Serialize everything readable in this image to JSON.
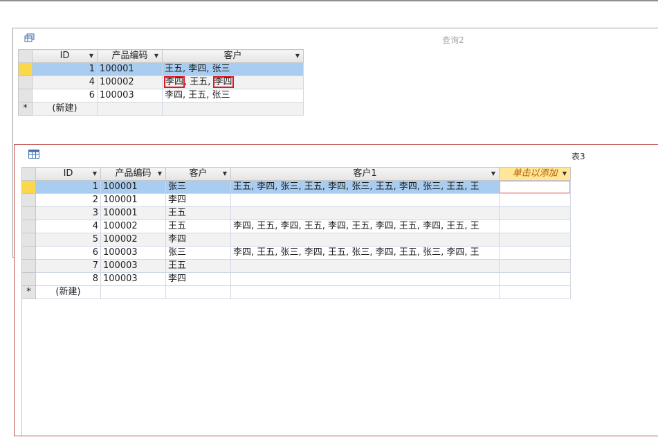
{
  "query_window": {
    "title": "查询2",
    "icon": "query-icon",
    "columns": [
      "ID",
      "产品编码",
      "客户"
    ],
    "rows": [
      {
        "id": "1",
        "code": "100001",
        "customer_parts": [
          "王五, 李四, 张三"
        ]
      },
      {
        "id": "4",
        "code": "100002",
        "customer_parts": [
          "李四",
          ", 王五, ",
          "李四"
        ]
      },
      {
        "id": "6",
        "code": "100003",
        "customer_parts": [
          "李四, 王五, 张三"
        ]
      }
    ],
    "new_row_label": "(新建)",
    "new_row_marker": "*"
  },
  "table_window": {
    "title": "表3",
    "icon": "table-icon",
    "columns": [
      "ID",
      "产品编码",
      "客户",
      "客户1",
      "单击以添加"
    ],
    "rows": [
      {
        "id": "1",
        "code": "100001",
        "customer": "张三",
        "customer1": "王五, 李四, 张三, 王五, 李四, 张三, 王五, 李四, 张三, 王五, 王"
      },
      {
        "id": "2",
        "code": "100001",
        "customer": "李四",
        "customer1": ""
      },
      {
        "id": "3",
        "code": "100001",
        "customer": "王五",
        "customer1": ""
      },
      {
        "id": "4",
        "code": "100002",
        "customer": "王五",
        "customer1": "李四, 王五, 李四, 王五, 李四, 王五, 李四, 王五, 李四, 王五, 王"
      },
      {
        "id": "5",
        "code": "100002",
        "customer": "李四",
        "customer1": ""
      },
      {
        "id": "6",
        "code": "100003",
        "customer": "张三",
        "customer1": "李四, 王五, 张三, 李四, 王五, 张三, 李四, 王五, 张三, 李四, 王"
      },
      {
        "id": "7",
        "code": "100003",
        "customer": "王五",
        "customer1": ""
      },
      {
        "id": "8",
        "code": "100003",
        "customer": "李四",
        "customer1": ""
      }
    ],
    "new_row_label": "(新建)",
    "new_row_marker": "*"
  },
  "colors": {
    "selected_row": "#a8cdf1",
    "current_row_selector": "#fbd849",
    "highlight_box": "#e0191e",
    "active_window_border": "#c0504d"
  }
}
